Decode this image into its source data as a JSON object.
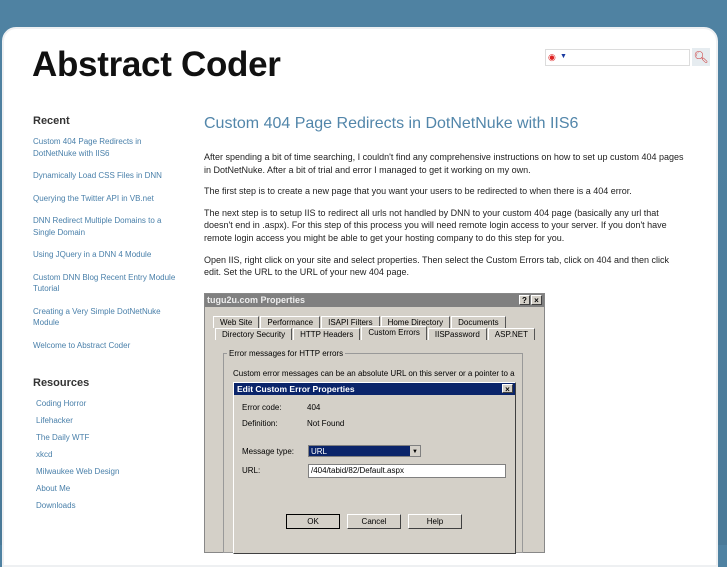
{
  "site": {
    "title": "Abstract Coder"
  },
  "search": {
    "placeholder": "",
    "value": ""
  },
  "sidebar": {
    "recent_heading": "Recent",
    "recent": [
      "Custom 404 Page Redirects in DotNetNuke with IIS6",
      "Dynamically Load CSS Files in DNN",
      "Querying the Twitter API in VB.net",
      "DNN Redirect Multiple Domains to a Single Domain",
      "Using JQuery in a DNN 4 Module",
      "Custom DNN Blog Recent Entry Module Tutorial",
      "Creating a Very Simple DotNetNuke Module",
      "Welcome to Abstract Coder"
    ],
    "resources_heading": "Resources",
    "resources": [
      "Coding Horror",
      "Lifehacker",
      "The Daily WTF",
      "xkcd",
      "Milwaukee Web Design",
      "About Me",
      "Downloads"
    ]
  },
  "post": {
    "title": "Custom 404 Page Redirects in DotNetNuke with IIS6",
    "paragraphs": [
      "After spending a bit of time searching, I couldn't find any comprehensive instructions on how to set up custom 404 pages in DotNetNuke. After a bit of trial and error I managed to get it working on my own.",
      "The first step is to create a new page that you want your users to be redirected to when there is a 404 error.",
      "The next step is to setup IIS to redirect all urls not handled by DNN to your custom 404 page (basically any url that doesn't end in .aspx). For this step of this process you will need remote login access to your server. If you don't have remote login access you might be able to get your hosting company to do this step for you.",
      "Open IIS, right click on your site and select properties. Then select the Custom Errors tab, click on 404 and then click edit. Set the URL to the URL of your new 404 page."
    ]
  },
  "screenshot": {
    "window_title": "tugu2u.com Properties",
    "help": "?",
    "close": "×",
    "tabs_row1": [
      "Web Site",
      "Performance",
      "ISAPI Filters",
      "Home Directory",
      "Documents"
    ],
    "tabs_row2": [
      "Directory Security",
      "HTTP Headers",
      "Custom Errors",
      "IISPassword",
      "ASP.NET"
    ],
    "group_label": "Error messages for HTTP errors",
    "group_text": "Custom error messages can be an absolute URL on this server or a pointer to a",
    "dialog_title": "Edit Custom Error Properties",
    "error_code_label": "Error code:",
    "error_code": "404",
    "definition_label": "Definition:",
    "definition": "Not Found",
    "message_type_label": "Message type:",
    "message_type": "URL",
    "url_label": "URL:",
    "url": "/404/tabid/82/Default.aspx",
    "ok": "OK",
    "cancel": "Cancel",
    "help_btn": "Help"
  }
}
